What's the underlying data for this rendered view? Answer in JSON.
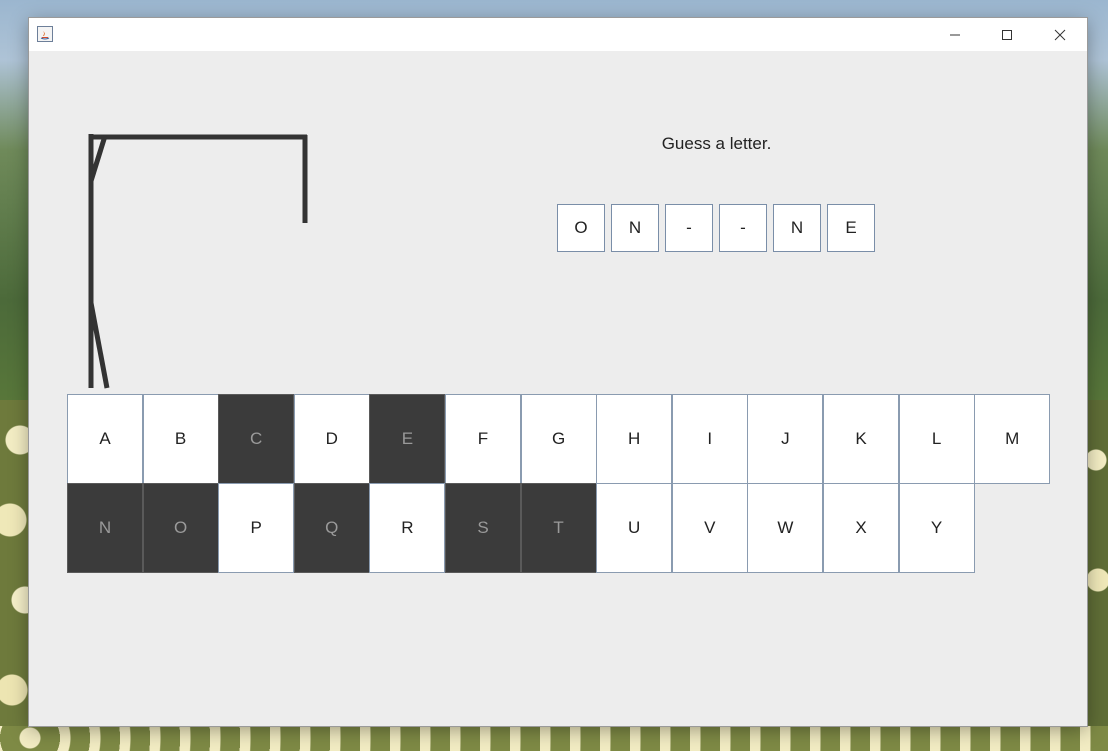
{
  "window": {
    "title": "",
    "controls": {
      "minimize": "minimize-icon",
      "maximize": "maximize-icon",
      "close": "close-icon"
    }
  },
  "status_text": "Guess a letter.",
  "word": [
    "O",
    "N",
    "-",
    "-",
    "N",
    "E"
  ],
  "keys": [
    {
      "letter": "A",
      "used": false
    },
    {
      "letter": "B",
      "used": false
    },
    {
      "letter": "C",
      "used": true
    },
    {
      "letter": "D",
      "used": false
    },
    {
      "letter": "E",
      "used": true
    },
    {
      "letter": "F",
      "used": false
    },
    {
      "letter": "G",
      "used": false
    },
    {
      "letter": "H",
      "used": false
    },
    {
      "letter": "I",
      "used": false
    },
    {
      "letter": "J",
      "used": false
    },
    {
      "letter": "K",
      "used": false
    },
    {
      "letter": "L",
      "used": false
    },
    {
      "letter": "M",
      "used": false
    },
    {
      "letter": "N",
      "used": true
    },
    {
      "letter": "O",
      "used": true
    },
    {
      "letter": "P",
      "used": false
    },
    {
      "letter": "Q",
      "used": true
    },
    {
      "letter": "R",
      "used": false
    },
    {
      "letter": "S",
      "used": true
    },
    {
      "letter": "T",
      "used": true
    },
    {
      "letter": "U",
      "used": false
    },
    {
      "letter": "V",
      "used": false
    },
    {
      "letter": "W",
      "used": false
    },
    {
      "letter": "X",
      "used": false
    },
    {
      "letter": "Y",
      "used": false
    }
  ],
  "colors": {
    "used_key_bg": "#3b3b3b",
    "available_key_bg": "#ffffff",
    "panel_bg": "#ededed"
  }
}
